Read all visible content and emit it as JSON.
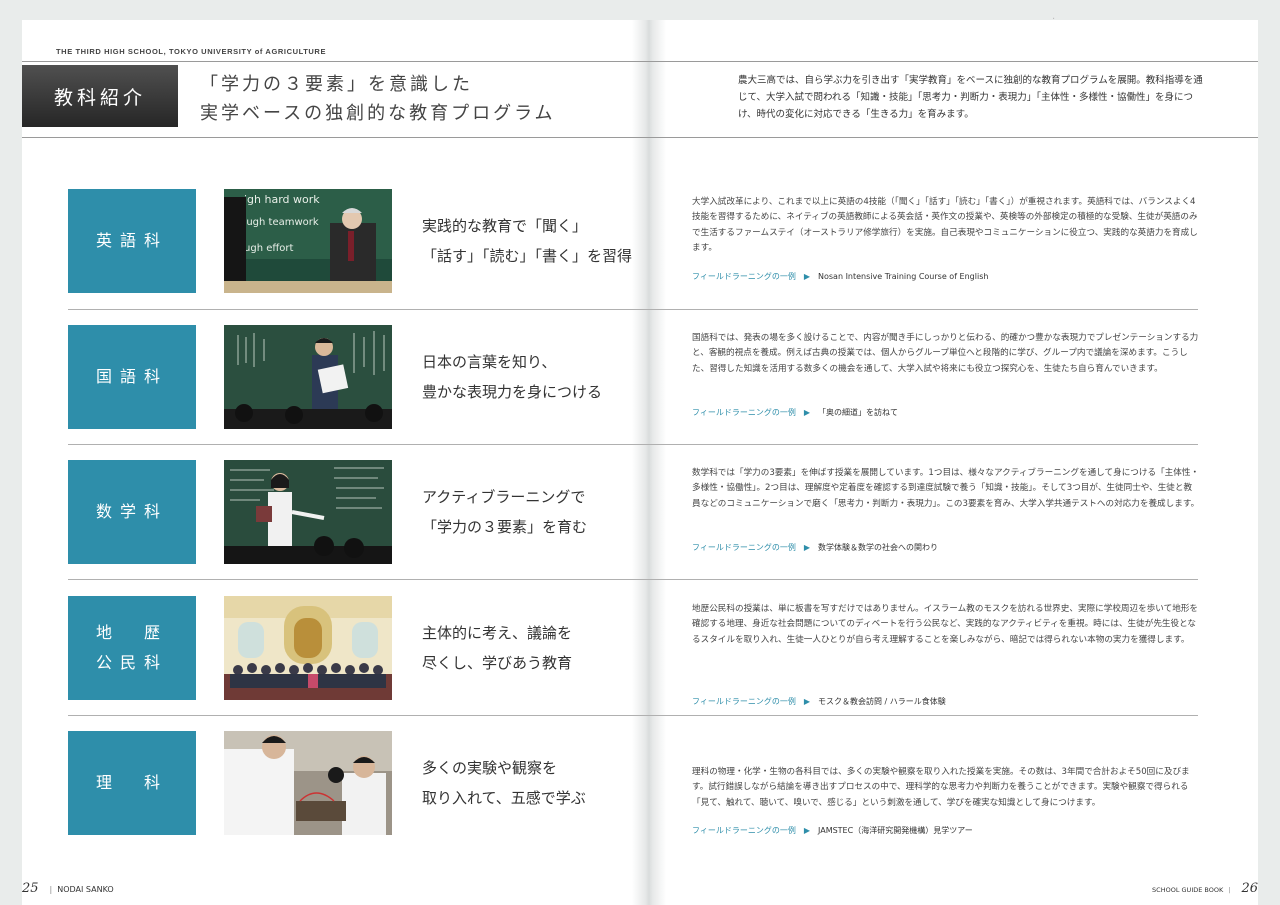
{
  "header": {
    "school_line": "THE THIRD HIGH SCHOOL, TOKYO UNIVERSITY of AGRICULTURE",
    "section_tag": "教科紹介",
    "headline_1": "「学力の３要素」を意識した",
    "headline_2": "実学ベースの独創的な教育プログラム",
    "intro": "農大三高では、自ら学ぶ力を引き出す「実学教育」をベースに独創的な教育プログラムを展開。教科指導を通じて、大学入試で問われる「知識・技能」「思考力・判断力・表現力」「主体性・多様性・協働性」を身につけ、時代の変化に対応できる「生きる力」を育みます。"
  },
  "field_label": "フィールドラーニングの一例",
  "subjects": [
    {
      "name_1": "英語科",
      "name_2": "",
      "tagline_1": "実践的な教育で「聞く」",
      "tagline_2": "「話す」「読む」「書く」を習得",
      "desc": "大学入試改革により、これまで以上に英語の4技能（「聞く」「話す」「読む」「書く」）が重視されます。英語科では、バランスよく4技能を習得するために、ネイティブの英語教師による英会話・英作文の授業や、英検等の外部検定の積極的な受験、生徒が英語のみで生活するファームステイ（オーストラリア修学旅行）を実施。自己表現やコミュニケーションに役立つ、実践的な英語力を育成します。",
      "field_item": "Nosan Intensive Training Course of English",
      "photo": "english-class-photo"
    },
    {
      "name_1": "国語科",
      "name_2": "",
      "tagline_1": "日本の言葉を知り、",
      "tagline_2": "豊かな表現力を身につける",
      "desc": "国語科では、発表の場を多く設けることで、内容が聞き手にしっかりと伝わる、的確かつ豊かな表現力でプレゼンテーションする力と、客観的視点を養成。例えば古典の授業では、個人からグループ単位へと段階的に学び、グループ内で議論を深めます。こうした、習得した知識を活用する数多くの機会を通して、大学入試や将来にも役立つ探究心を、生徒たち自ら育んでいきます。",
      "field_item": "「奥の細道」を訪ねて",
      "photo": "japanese-class-photo"
    },
    {
      "name_1": "数学科",
      "name_2": "",
      "tagline_1": "アクティブラーニングで",
      "tagline_2": "「学力の３要素」を育む",
      "desc": "数学科では「学力の3要素」を伸ばす授業を展開しています。1つ目は、様々なアクティブラーニングを通して身につける「主体性・多様性・協働性」。2つ目は、理解度や定着度を確認する到達度試験で養う「知識・技能」。そして3つ目が、生徒同士や、生徒と教員などのコミュニケーションで磨く「思考力・判断力・表現力」。この3要素を育み、大学入学共通テストへの対応力を養成します。",
      "field_item": "数学体験＆数学の社会への関わり",
      "photo": "math-class-photo"
    },
    {
      "name_1": "地　歴",
      "name_2": "公民科",
      "tagline_1": "主体的に考え、議論を",
      "tagline_2": "尽くし、学びあう教育",
      "desc": "地歴公民科の授業は、単に板書を写すだけではありません。イスラーム教のモスクを訪れる世界史、実際に学校周辺を歩いて地形を確認する地理、身近な社会問題についてのディベートを行う公民など、実践的なアクティビティを重視。時には、生徒が先生役となるスタイルを取り入れ、生徒一人ひとりが自ら考え理解することを楽しみながら、暗記では得られない本物の実力を獲得します。",
      "field_item": "モスク＆教会訪問 / ハラール食体験",
      "photo": "mosque-visit-photo"
    },
    {
      "name_1": "理　科",
      "name_2": "",
      "tagline_1": "多くの実験や観察を",
      "tagline_2": "取り入れて、五感で学ぶ",
      "desc": "理科の物理・化学・生物の各科目では、多くの実験や観察を取り入れた授業を実施。その数は、3年間で合計およそ50回に及びます。試行錯誤しながら結論を導き出すプロセスの中で、理科学的な思考力や判断力を養うことができます。実験や観察で得られる「見て、触れて、聴いて、嗅いで、感じる」という刺激を通して、学びを確実な知識として身につけます。",
      "field_item": "JAMSTEC（海洋研究開発機構）見学ツアー",
      "photo": "science-lab-photo"
    }
  ],
  "footer": {
    "left_page": "25",
    "left_text": "NODAI SANKO",
    "right_text": "SCHOOL GUIDE BOOK",
    "right_page": "26"
  },
  "colors": {
    "accent": "#2e8eaa",
    "tag_bg": "#3a3a3a"
  }
}
